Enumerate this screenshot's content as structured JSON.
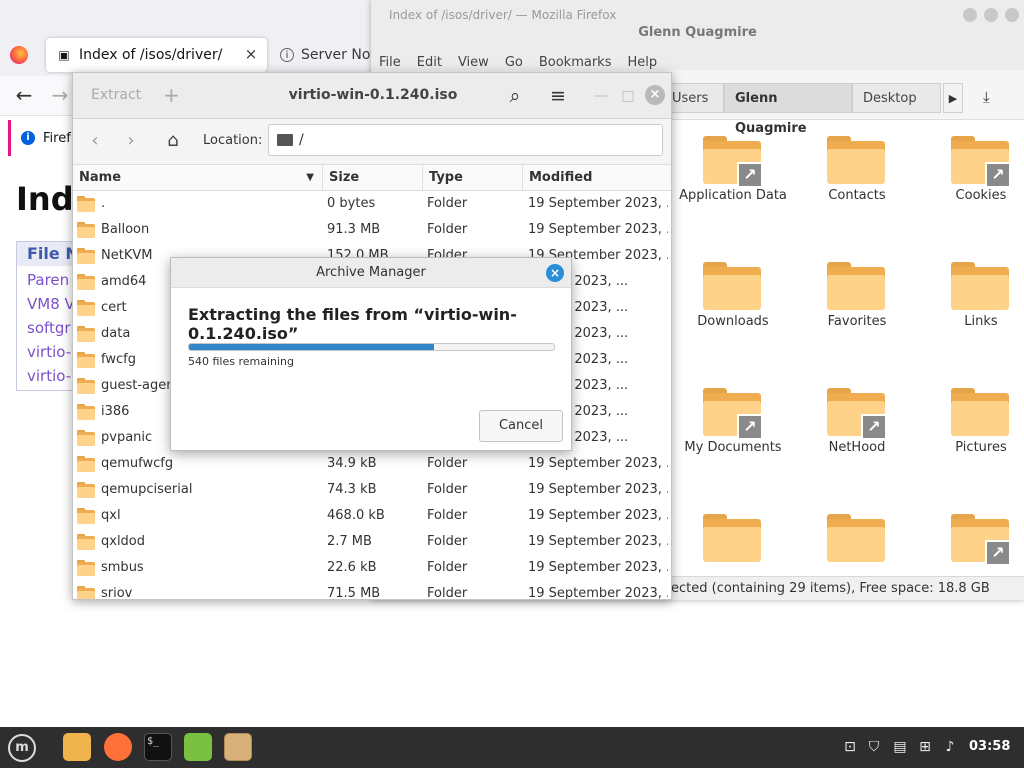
{
  "firefox": {
    "window_title": "Index of /isos/driver/ — Mozilla Firefox",
    "tabs": [
      {
        "label": "Index of /isos/driver/",
        "active": true
      },
      {
        "label": "Server Not",
        "active": false
      }
    ],
    "notice_text": "Firef",
    "page_heading": "Ind",
    "table_header": "File N",
    "links": [
      "Paren",
      "VM8 V",
      "softgr",
      "virtio-",
      "virtio-"
    ]
  },
  "caja": {
    "title": "Glenn Quagmire",
    "menu": [
      "File",
      "Edit",
      "View",
      "Go",
      "Bookmarks",
      "Help"
    ],
    "breadcrumbs": [
      "Users",
      "Glenn Quagmire",
      "Desktop"
    ],
    "icons": [
      {
        "label": "Application Data",
        "symlink": true
      },
      {
        "label": "Contacts",
        "symlink": false
      },
      {
        "label": "Cookies",
        "symlink": true
      },
      {
        "label": "Downloads",
        "symlink": false
      },
      {
        "label": "Favorites",
        "symlink": false
      },
      {
        "label": "Links",
        "symlink": false
      },
      {
        "label": "My Documents",
        "symlink": true
      },
      {
        "label": "NetHood",
        "symlink": true
      },
      {
        "label": "Pictures",
        "symlink": false
      },
      {
        "label": "",
        "symlink": false
      },
      {
        "label": "",
        "symlink": false
      },
      {
        "label": "",
        "symlink": true
      }
    ],
    "status": "ected (containing 29 items), Free space: 18.8 GB"
  },
  "archive": {
    "title": "virtio-win-0.1.240.iso",
    "extract_label": "Extract",
    "add_label": "+",
    "location_label": "Location:",
    "location_value": "/",
    "columns": [
      "Name",
      "Size",
      "Type",
      "Modified"
    ],
    "rows": [
      {
        "name": ".",
        "size": "0 bytes",
        "type": "Folder",
        "modified": "19 September 2023, ..."
      },
      {
        "name": "Balloon",
        "size": "91.3 MB",
        "type": "Folder",
        "modified": "19 September 2023, ..."
      },
      {
        "name": "NetKVM",
        "size": "152.0 MB",
        "type": "Folder",
        "modified": "19 September 2023, ..."
      },
      {
        "name": "amd64",
        "size": "",
        "type": "",
        "modified": "ember 2023, ..."
      },
      {
        "name": "cert",
        "size": "",
        "type": "",
        "modified": "ember 2023, ..."
      },
      {
        "name": "data",
        "size": "",
        "type": "",
        "modified": "ember 2023, ..."
      },
      {
        "name": "fwcfg",
        "size": "",
        "type": "",
        "modified": "ember 2023, ..."
      },
      {
        "name": "guest-agent",
        "size": "",
        "type": "",
        "modified": "ember 2023, ..."
      },
      {
        "name": "i386",
        "size": "",
        "type": "",
        "modified": "ember 2023, ..."
      },
      {
        "name": "pvpanic",
        "size": "",
        "type": "",
        "modified": "ember 2023, ..."
      },
      {
        "name": "qemufwcfg",
        "size": "34.9 kB",
        "type": "Folder",
        "modified": "19 September 2023, ..."
      },
      {
        "name": "qemupciserial",
        "size": "74.3 kB",
        "type": "Folder",
        "modified": "19 September 2023, ..."
      },
      {
        "name": "qxl",
        "size": "468.0 kB",
        "type": "Folder",
        "modified": "19 September 2023, ..."
      },
      {
        "name": "qxldod",
        "size": "2.7 MB",
        "type": "Folder",
        "modified": "19 September 2023, ..."
      },
      {
        "name": "smbus",
        "size": "22.6 kB",
        "type": "Folder",
        "modified": "19 September 2023, ..."
      },
      {
        "name": "sriov",
        "size": "71.5 MB",
        "type": "Folder",
        "modified": "19 September 2023, ..."
      }
    ]
  },
  "dialog": {
    "title": "Archive Manager",
    "heading": "Extracting the files from “virtio-win-0.1.240.iso”",
    "progress": 0.67,
    "remaining": "540 files remaining",
    "cancel_label": "Cancel"
  },
  "taskbar": {
    "clock": "03:58",
    "apps": [
      "files",
      "firefox",
      "terminal",
      "mintinstall",
      "archive-manager"
    ],
    "tray_icons": [
      "update-icon",
      "shield-icon",
      "clipboard-icon",
      "network-icon",
      "volume-icon"
    ]
  },
  "colors": {
    "accent": "#2f86c9",
    "folder": "#f0ad50",
    "taskbar": "#2e2e2e"
  }
}
